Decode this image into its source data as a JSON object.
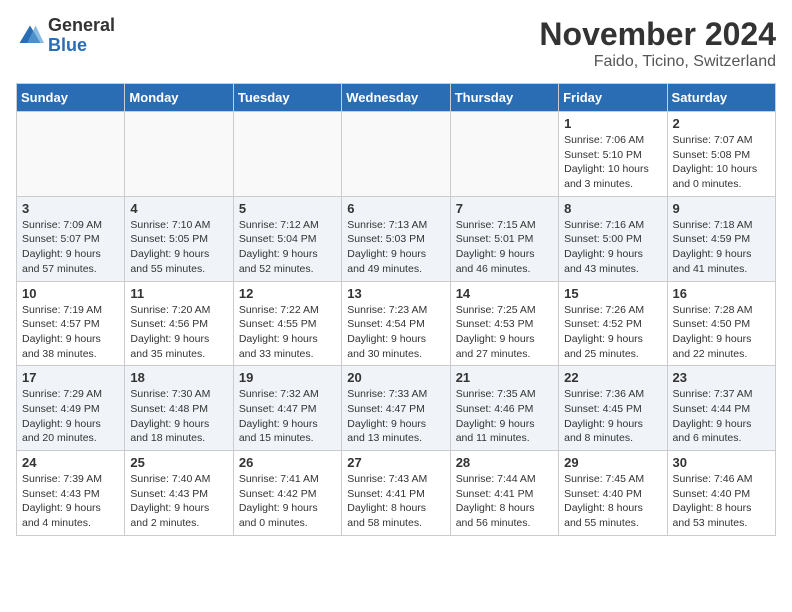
{
  "logo": {
    "general": "General",
    "blue": "Blue"
  },
  "title": "November 2024",
  "location": "Faido, Ticino, Switzerland",
  "weekdays": [
    "Sunday",
    "Monday",
    "Tuesday",
    "Wednesday",
    "Thursday",
    "Friday",
    "Saturday"
  ],
  "weeks": [
    [
      {
        "day": "",
        "info": ""
      },
      {
        "day": "",
        "info": ""
      },
      {
        "day": "",
        "info": ""
      },
      {
        "day": "",
        "info": ""
      },
      {
        "day": "",
        "info": ""
      },
      {
        "day": "1",
        "info": "Sunrise: 7:06 AM\nSunset: 5:10 PM\nDaylight: 10 hours\nand 3 minutes."
      },
      {
        "day": "2",
        "info": "Sunrise: 7:07 AM\nSunset: 5:08 PM\nDaylight: 10 hours\nand 0 minutes."
      }
    ],
    [
      {
        "day": "3",
        "info": "Sunrise: 7:09 AM\nSunset: 5:07 PM\nDaylight: 9 hours\nand 57 minutes."
      },
      {
        "day": "4",
        "info": "Sunrise: 7:10 AM\nSunset: 5:05 PM\nDaylight: 9 hours\nand 55 minutes."
      },
      {
        "day": "5",
        "info": "Sunrise: 7:12 AM\nSunset: 5:04 PM\nDaylight: 9 hours\nand 52 minutes."
      },
      {
        "day": "6",
        "info": "Sunrise: 7:13 AM\nSunset: 5:03 PM\nDaylight: 9 hours\nand 49 minutes."
      },
      {
        "day": "7",
        "info": "Sunrise: 7:15 AM\nSunset: 5:01 PM\nDaylight: 9 hours\nand 46 minutes."
      },
      {
        "day": "8",
        "info": "Sunrise: 7:16 AM\nSunset: 5:00 PM\nDaylight: 9 hours\nand 43 minutes."
      },
      {
        "day": "9",
        "info": "Sunrise: 7:18 AM\nSunset: 4:59 PM\nDaylight: 9 hours\nand 41 minutes."
      }
    ],
    [
      {
        "day": "10",
        "info": "Sunrise: 7:19 AM\nSunset: 4:57 PM\nDaylight: 9 hours\nand 38 minutes."
      },
      {
        "day": "11",
        "info": "Sunrise: 7:20 AM\nSunset: 4:56 PM\nDaylight: 9 hours\nand 35 minutes."
      },
      {
        "day": "12",
        "info": "Sunrise: 7:22 AM\nSunset: 4:55 PM\nDaylight: 9 hours\nand 33 minutes."
      },
      {
        "day": "13",
        "info": "Sunrise: 7:23 AM\nSunset: 4:54 PM\nDaylight: 9 hours\nand 30 minutes."
      },
      {
        "day": "14",
        "info": "Sunrise: 7:25 AM\nSunset: 4:53 PM\nDaylight: 9 hours\nand 27 minutes."
      },
      {
        "day": "15",
        "info": "Sunrise: 7:26 AM\nSunset: 4:52 PM\nDaylight: 9 hours\nand 25 minutes."
      },
      {
        "day": "16",
        "info": "Sunrise: 7:28 AM\nSunset: 4:50 PM\nDaylight: 9 hours\nand 22 minutes."
      }
    ],
    [
      {
        "day": "17",
        "info": "Sunrise: 7:29 AM\nSunset: 4:49 PM\nDaylight: 9 hours\nand 20 minutes."
      },
      {
        "day": "18",
        "info": "Sunrise: 7:30 AM\nSunset: 4:48 PM\nDaylight: 9 hours\nand 18 minutes."
      },
      {
        "day": "19",
        "info": "Sunrise: 7:32 AM\nSunset: 4:47 PM\nDaylight: 9 hours\nand 15 minutes."
      },
      {
        "day": "20",
        "info": "Sunrise: 7:33 AM\nSunset: 4:47 PM\nDaylight: 9 hours\nand 13 minutes."
      },
      {
        "day": "21",
        "info": "Sunrise: 7:35 AM\nSunset: 4:46 PM\nDaylight: 9 hours\nand 11 minutes."
      },
      {
        "day": "22",
        "info": "Sunrise: 7:36 AM\nSunset: 4:45 PM\nDaylight: 9 hours\nand 8 minutes."
      },
      {
        "day": "23",
        "info": "Sunrise: 7:37 AM\nSunset: 4:44 PM\nDaylight: 9 hours\nand 6 minutes."
      }
    ],
    [
      {
        "day": "24",
        "info": "Sunrise: 7:39 AM\nSunset: 4:43 PM\nDaylight: 9 hours\nand 4 minutes."
      },
      {
        "day": "25",
        "info": "Sunrise: 7:40 AM\nSunset: 4:43 PM\nDaylight: 9 hours\nand 2 minutes."
      },
      {
        "day": "26",
        "info": "Sunrise: 7:41 AM\nSunset: 4:42 PM\nDaylight: 9 hours\nand 0 minutes."
      },
      {
        "day": "27",
        "info": "Sunrise: 7:43 AM\nSunset: 4:41 PM\nDaylight: 8 hours\nand 58 minutes."
      },
      {
        "day": "28",
        "info": "Sunrise: 7:44 AM\nSunset: 4:41 PM\nDaylight: 8 hours\nand 56 minutes."
      },
      {
        "day": "29",
        "info": "Sunrise: 7:45 AM\nSunset: 4:40 PM\nDaylight: 8 hours\nand 55 minutes."
      },
      {
        "day": "30",
        "info": "Sunrise: 7:46 AM\nSunset: 4:40 PM\nDaylight: 8 hours\nand 53 minutes."
      }
    ]
  ]
}
